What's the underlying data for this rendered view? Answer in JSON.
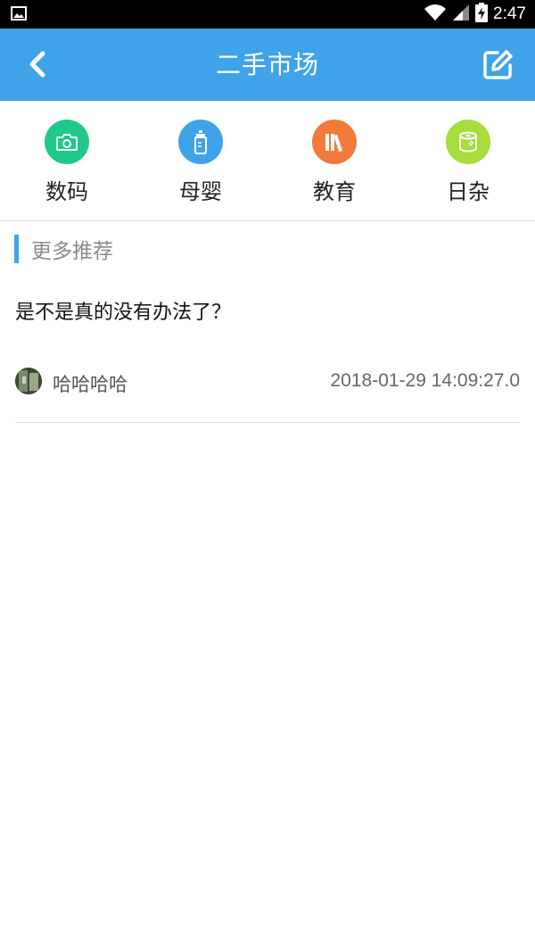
{
  "status": {
    "time": "2:47"
  },
  "header": {
    "title": "二手市场"
  },
  "categories": [
    {
      "label": "数码",
      "color": "#1ec98a",
      "icon": "camera-icon"
    },
    {
      "label": "母婴",
      "color": "#3fa3ea",
      "icon": "baby-bottle-icon"
    },
    {
      "label": "教育",
      "color": "#f07b3a",
      "icon": "books-icon"
    },
    {
      "label": "日杂",
      "color": "#a6de3b",
      "icon": "tissue-roll-icon"
    }
  ],
  "section": {
    "title": "更多推荐"
  },
  "posts": [
    {
      "title": "是不是真的没有办法了？",
      "author": "哈哈哈哈",
      "time": "2018-01-29 14:09:27.0"
    }
  ],
  "colors": {
    "primary": "#3fa3ea",
    "statusbar": "#000000"
  }
}
